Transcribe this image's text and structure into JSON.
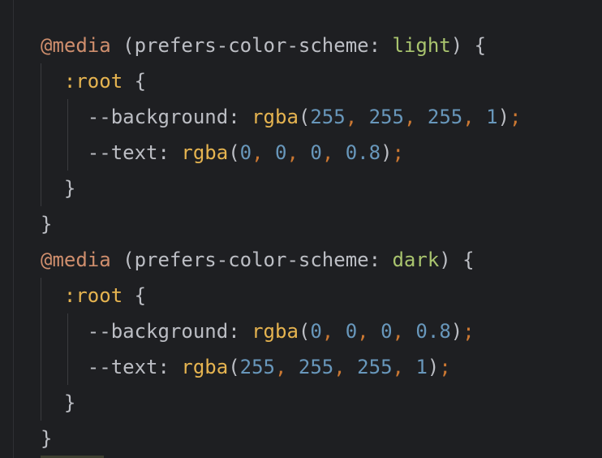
{
  "editor": {
    "lines": [
      {
        "segments": [
          {
            "cls": "at",
            "text": "@media"
          },
          {
            "cls": "plain",
            "text": " (prefers-color-scheme: "
          },
          {
            "cls": "value",
            "text": "light"
          },
          {
            "cls": "plain",
            "text": ") {"
          }
        ]
      },
      {
        "segments": [
          {
            "cls": "plain",
            "text": "  "
          },
          {
            "cls": "selector",
            "text": ":root"
          },
          {
            "cls": "plain",
            "text": " {"
          }
        ]
      },
      {
        "segments": [
          {
            "cls": "plain",
            "text": "    --background: "
          },
          {
            "cls": "func",
            "text": "rgba"
          },
          {
            "cls": "punct",
            "text": "("
          },
          {
            "cls": "num",
            "text": "255"
          },
          {
            "cls": "comma",
            "text": ","
          },
          {
            "cls": "plain",
            "text": " "
          },
          {
            "cls": "num",
            "text": "255"
          },
          {
            "cls": "comma",
            "text": ","
          },
          {
            "cls": "plain",
            "text": " "
          },
          {
            "cls": "num",
            "text": "255"
          },
          {
            "cls": "comma",
            "text": ","
          },
          {
            "cls": "plain",
            "text": " "
          },
          {
            "cls": "num",
            "text": "1"
          },
          {
            "cls": "punct",
            "text": ")"
          },
          {
            "cls": "semi",
            "text": ";"
          }
        ]
      },
      {
        "segments": [
          {
            "cls": "plain",
            "text": "    --text: "
          },
          {
            "cls": "func",
            "text": "rgba"
          },
          {
            "cls": "punct",
            "text": "("
          },
          {
            "cls": "num",
            "text": "0"
          },
          {
            "cls": "comma",
            "text": ","
          },
          {
            "cls": "plain",
            "text": " "
          },
          {
            "cls": "num",
            "text": "0"
          },
          {
            "cls": "comma",
            "text": ","
          },
          {
            "cls": "plain",
            "text": " "
          },
          {
            "cls": "num",
            "text": "0"
          },
          {
            "cls": "comma",
            "text": ","
          },
          {
            "cls": "plain",
            "text": " "
          },
          {
            "cls": "num",
            "text": "0.8"
          },
          {
            "cls": "punct",
            "text": ")"
          },
          {
            "cls": "semi",
            "text": ";"
          }
        ]
      },
      {
        "segments": [
          {
            "cls": "plain",
            "text": "  }"
          }
        ]
      },
      {
        "segments": [
          {
            "cls": "plain",
            "text": "}"
          }
        ]
      },
      {
        "segments": [
          {
            "cls": "at",
            "text": "@media"
          },
          {
            "cls": "plain",
            "text": " (prefers-color-scheme: "
          },
          {
            "cls": "value",
            "text": "dark"
          },
          {
            "cls": "plain",
            "text": ") {"
          }
        ]
      },
      {
        "segments": [
          {
            "cls": "plain",
            "text": "  "
          },
          {
            "cls": "selector",
            "text": ":root"
          },
          {
            "cls": "plain",
            "text": " {"
          }
        ]
      },
      {
        "segments": [
          {
            "cls": "plain",
            "text": "    --background: "
          },
          {
            "cls": "func",
            "text": "rgba"
          },
          {
            "cls": "punct",
            "text": "("
          },
          {
            "cls": "num",
            "text": "0"
          },
          {
            "cls": "comma",
            "text": ","
          },
          {
            "cls": "plain",
            "text": " "
          },
          {
            "cls": "num",
            "text": "0"
          },
          {
            "cls": "comma",
            "text": ","
          },
          {
            "cls": "plain",
            "text": " "
          },
          {
            "cls": "num",
            "text": "0"
          },
          {
            "cls": "comma",
            "text": ","
          },
          {
            "cls": "plain",
            "text": " "
          },
          {
            "cls": "num",
            "text": "0.8"
          },
          {
            "cls": "punct",
            "text": ")"
          },
          {
            "cls": "semi",
            "text": ";"
          }
        ]
      },
      {
        "segments": [
          {
            "cls": "plain",
            "text": "    --text: "
          },
          {
            "cls": "func",
            "text": "rgba"
          },
          {
            "cls": "punct",
            "text": "("
          },
          {
            "cls": "num",
            "text": "255"
          },
          {
            "cls": "comma",
            "text": ","
          },
          {
            "cls": "plain",
            "text": " "
          },
          {
            "cls": "num",
            "text": "255"
          },
          {
            "cls": "comma",
            "text": ","
          },
          {
            "cls": "plain",
            "text": " "
          },
          {
            "cls": "num",
            "text": "255"
          },
          {
            "cls": "comma",
            "text": ","
          },
          {
            "cls": "plain",
            "text": " "
          },
          {
            "cls": "num",
            "text": "1"
          },
          {
            "cls": "punct",
            "text": ")"
          },
          {
            "cls": "semi",
            "text": ";"
          }
        ]
      },
      {
        "segments": [
          {
            "cls": "plain",
            "text": "  }"
          }
        ]
      },
      {
        "segments": [
          {
            "cls": "plain",
            "text": "}"
          }
        ]
      }
    ]
  },
  "colors": {
    "background": "#1e1f22",
    "at_rule": "#cf8e6d",
    "value_keyword": "#a9c46e",
    "function_and_selector": "#e6b450",
    "number": "#6897bb",
    "punctuation": "#cc7832",
    "text": "#bcbec4"
  }
}
